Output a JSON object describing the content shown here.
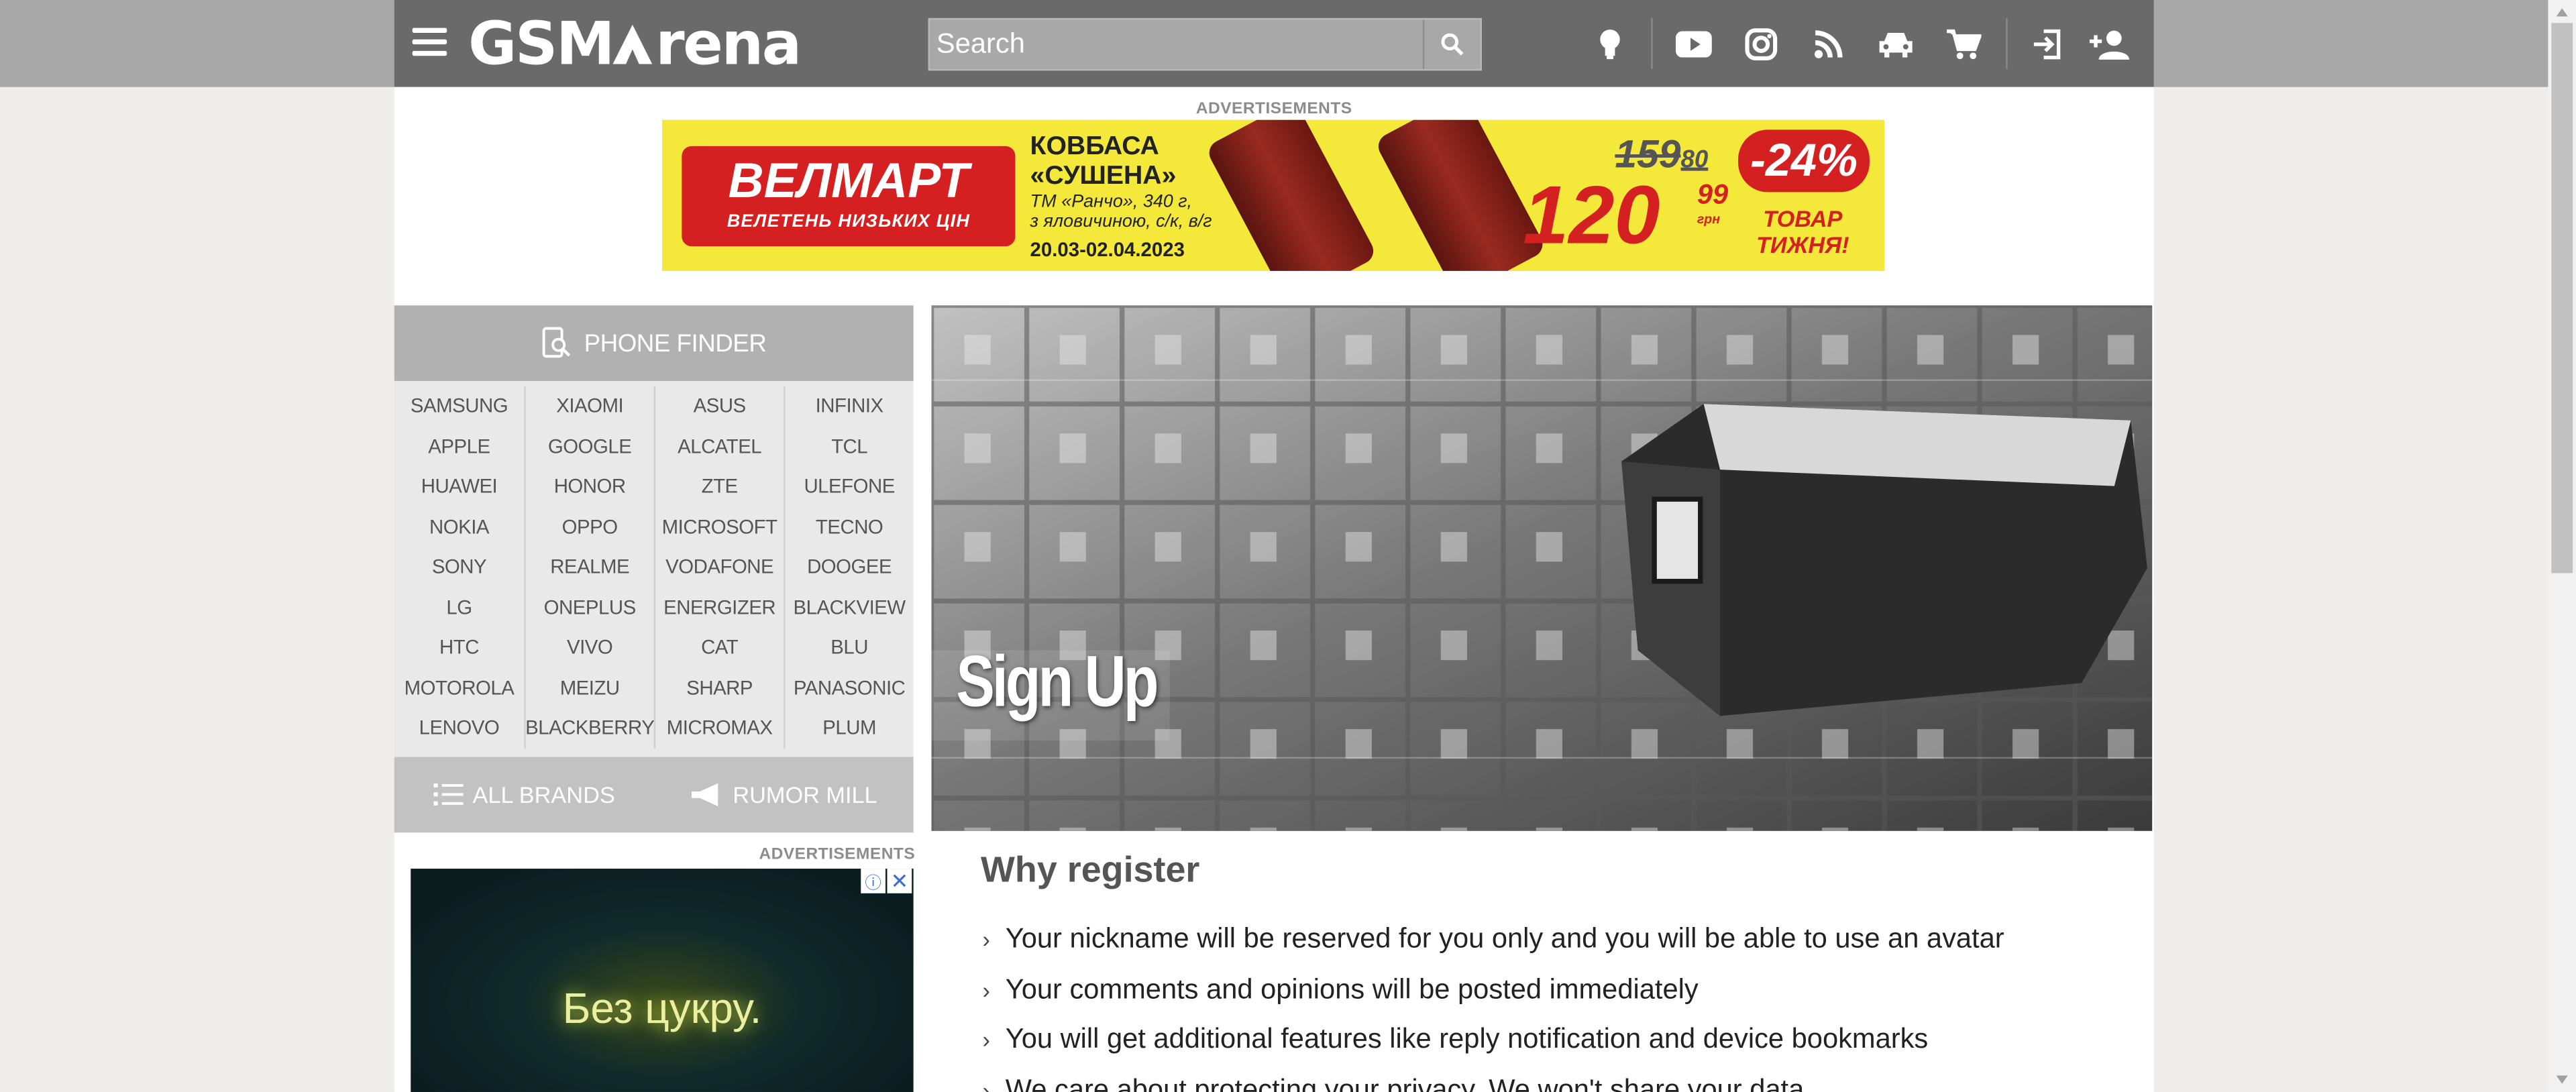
{
  "header": {
    "logo_text": "GSMArena",
    "search_placeholder": "Search",
    "icons": [
      "lightbulb-icon",
      "youtube-icon",
      "instagram-icon",
      "rss-icon",
      "car-icon",
      "cart-icon",
      "login-icon",
      "add-user-icon"
    ]
  },
  "top_ad": {
    "label": "ADVERTISEMENTS",
    "brand": "ВЕЛМАРТ",
    "slogan": "ВЕЛЕТЕНЬ НИЗЬКИХ ЦІН",
    "product_line1": "КОВБАСА",
    "product_line2": "«СУШЕНА»",
    "detail1": "ТМ «Ранчо», 340 г,",
    "detail2": "з яловичиною, с/к, в/г",
    "dates": "20.03-02.04.2023",
    "old_price": "159",
    "old_cents": "80",
    "new_price": "120",
    "new_cents": "99",
    "currency": "грн",
    "discount": "-24%",
    "tag_line1": "ТОВАР",
    "tag_line2": "ТИЖНЯ!"
  },
  "phone_finder": {
    "title": "PHONE FINDER",
    "columns": [
      [
        "SAMSUNG",
        "APPLE",
        "HUAWEI",
        "NOKIA",
        "SONY",
        "LG",
        "HTC",
        "MOTOROLA",
        "LENOVO"
      ],
      [
        "XIAOMI",
        "GOOGLE",
        "HONOR",
        "OPPO",
        "REALME",
        "ONEPLUS",
        "VIVO",
        "MEIZU",
        "BLACKBERRY"
      ],
      [
        "ASUS",
        "ALCATEL",
        "ZTE",
        "MICROSOFT",
        "VODAFONE",
        "ENERGIZER",
        "CAT",
        "SHARP",
        "MICROMAX"
      ],
      [
        "INFINIX",
        "TCL",
        "ULEFONE",
        "TECNO",
        "DOOGEE",
        "BLACKVIEW",
        "BLU",
        "PANASONIC",
        "PLUM"
      ]
    ],
    "all_brands": "ALL BRANDS",
    "rumor_mill": "RUMOR MILL"
  },
  "side_ad": {
    "label": "ADVERTISEMENTS",
    "text": "Без цукру."
  },
  "hero": {
    "title": "Sign Up"
  },
  "why": {
    "title": "Why register",
    "reasons": [
      "Your nickname will be reserved for you only and you will be able to use an avatar",
      "Your comments and opinions will be posted immediately",
      "You will get additional features like reply notification and device bookmarks",
      "We care about protecting your privacy. We won't share your data"
    ]
  },
  "colors": {
    "header_bg": "#6a6a6a",
    "finder_head": "#b1b1b1",
    "ad_yellow": "#f4e83a",
    "ad_red": "#d42020"
  }
}
